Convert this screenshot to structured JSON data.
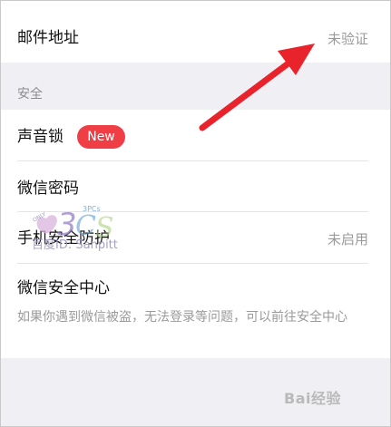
{
  "email": {
    "label": "邮件地址",
    "status": "未验证"
  },
  "security": {
    "header": "安全",
    "voice_lock": {
      "label": "声音锁",
      "badge": "New"
    },
    "wechat_password": {
      "label": "微信密码"
    },
    "phone_protection": {
      "label": "手机安全防护",
      "status": "未启用"
    },
    "security_center": {
      "label": "微信安全中心",
      "description": "如果你遇到微信被盗，无法登录等问题，可以前往安全中心"
    }
  },
  "watermark": {
    "text": "百度ID: Sanpitt",
    "logo_text": "3PCs"
  },
  "baidu_watermark": "Bai经验",
  "colors": {
    "badge": "#ef3e46",
    "arrow": "#e8232c",
    "background": "#efeff4"
  },
  "icons": {
    "arrow": "red-annotation-arrow"
  }
}
